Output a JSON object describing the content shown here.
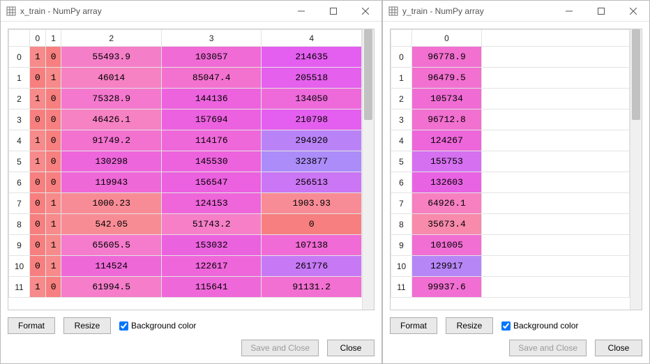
{
  "windows": {
    "left": {
      "title": "x_train - NumPy array",
      "columns": [
        "0",
        "1",
        "2",
        "3",
        "4"
      ],
      "row_headers": [
        "0",
        "1",
        "2",
        "3",
        "4",
        "5",
        "6",
        "7",
        "8",
        "9",
        "10",
        "11"
      ],
      "cells": [
        [
          {
            "v": "1",
            "c": "#f78a8a"
          },
          {
            "v": "0",
            "c": "#f77f7f"
          },
          {
            "v": "55493.9",
            "c": "#f57ec9"
          },
          {
            "v": "103057",
            "c": "#f06bd6"
          },
          {
            "v": "214635",
            "c": "#e45ef0"
          }
        ],
        [
          {
            "v": "0",
            "c": "#f77f7f"
          },
          {
            "v": "1",
            "c": "#f78a8a"
          },
          {
            "v": "46014",
            "c": "#f681c3"
          },
          {
            "v": "85047.4",
            "c": "#f372cf"
          },
          {
            "v": "205518",
            "c": "#e560ed"
          }
        ],
        [
          {
            "v": "1",
            "c": "#f78a8a"
          },
          {
            "v": "0",
            "c": "#f77f7f"
          },
          {
            "v": "75328.9",
            "c": "#f478ce"
          },
          {
            "v": "144136",
            "c": "#ec63dd"
          },
          {
            "v": "134050",
            "c": "#ee6adb"
          }
        ],
        [
          {
            "v": "0",
            "c": "#f77f7f"
          },
          {
            "v": "0",
            "c": "#f77f7f"
          },
          {
            "v": "46426.1",
            "c": "#f681c3"
          },
          {
            "v": "157694",
            "c": "#eb61df"
          },
          {
            "v": "210798",
            "c": "#e45fef"
          }
        ],
        [
          {
            "v": "1",
            "c": "#f78a8a"
          },
          {
            "v": "0",
            "c": "#f77f7f"
          },
          {
            "v": "91749.2",
            "c": "#f372cf"
          },
          {
            "v": "114176",
            "c": "#ef68d9"
          },
          {
            "v": "294920",
            "c": "#b983f7"
          }
        ],
        [
          {
            "v": "1",
            "c": "#f78a8a"
          },
          {
            "v": "0",
            "c": "#f77f7f"
          },
          {
            "v": "130298",
            "c": "#ee66db"
          },
          {
            "v": "145530",
            "c": "#ec63dd"
          },
          {
            "v": "323877",
            "c": "#ab8cf9"
          }
        ],
        [
          {
            "v": "0",
            "c": "#f77f7f"
          },
          {
            "v": "0",
            "c": "#f77f7f"
          },
          {
            "v": "119943",
            "c": "#ef68d8"
          },
          {
            "v": "156547",
            "c": "#eb61df"
          },
          {
            "v": "256513",
            "c": "#cb76f4"
          }
        ],
        [
          {
            "v": "0",
            "c": "#f77f7f"
          },
          {
            "v": "1",
            "c": "#f78a8a"
          },
          {
            "v": "1000.23",
            "c": "#f88c96"
          },
          {
            "v": "124153",
            "c": "#ee66da"
          },
          {
            "v": "1903.93",
            "c": "#f88c96"
          }
        ],
        [
          {
            "v": "0",
            "c": "#f77f7f"
          },
          {
            "v": "1",
            "c": "#f78a8a"
          },
          {
            "v": "542.05",
            "c": "#f88c95"
          },
          {
            "v": "51743.2",
            "c": "#f67fc8"
          },
          {
            "v": "0",
            "c": "#f77f7f"
          }
        ],
        [
          {
            "v": "0",
            "c": "#f77f7f"
          },
          {
            "v": "1",
            "c": "#f78a8a"
          },
          {
            "v": "65605.5",
            "c": "#f57bcc"
          },
          {
            "v": "153032",
            "c": "#eb62de"
          },
          {
            "v": "107138",
            "c": "#f06bd5"
          }
        ],
        [
          {
            "v": "0",
            "c": "#f77f7f"
          },
          {
            "v": "1",
            "c": "#f78a8a"
          },
          {
            "v": "114524",
            "c": "#ef68d8"
          },
          {
            "v": "122617",
            "c": "#ee66da"
          },
          {
            "v": "261776",
            "c": "#c779f5"
          }
        ],
        [
          {
            "v": "1",
            "c": "#f78a8a"
          },
          {
            "v": "0",
            "c": "#f77f7f"
          },
          {
            "v": "61994.5",
            "c": "#f57dca"
          },
          {
            "v": "115641",
            "c": "#ef68d9"
          },
          {
            "v": "91131.2",
            "c": "#f270d1"
          }
        ]
      ],
      "scroll_thumb": {
        "top": 0,
        "height": 130
      }
    },
    "right": {
      "title": "y_train - NumPy array",
      "columns": [
        "0"
      ],
      "row_headers": [
        "0",
        "1",
        "2",
        "3",
        "4",
        "5",
        "6",
        "7",
        "8",
        "9",
        "10",
        "11"
      ],
      "cells": [
        [
          {
            "v": "96778.9",
            "c": "#f270d0"
          }
        ],
        [
          {
            "v": "96479.5",
            "c": "#f270d0"
          }
        ],
        [
          {
            "v": "105734",
            "c": "#f06cd4"
          }
        ],
        [
          {
            "v": "96712.8",
            "c": "#f270d0"
          }
        ],
        [
          {
            "v": "124267",
            "c": "#ed66da"
          }
        ],
        [
          {
            "v": "155753",
            "c": "#d570f0"
          }
        ],
        [
          {
            "v": "132603",
            "c": "#e863e3"
          }
        ],
        [
          {
            "v": "64926.1",
            "c": "#f780c1"
          }
        ],
        [
          {
            "v": "35673.4",
            "c": "#f88aab"
          }
        ],
        [
          {
            "v": "101005",
            "c": "#f16ed3"
          }
        ],
        [
          {
            "v": "129917",
            "c": "#b786f6"
          }
        ],
        [
          {
            "v": "99937.6",
            "c": "#f16fd2"
          }
        ]
      ],
      "scroll_thumb": {
        "top": 0,
        "height": 130
      }
    }
  },
  "buttons": {
    "format": "Format",
    "resize": "Resize",
    "bg_color": "Background color",
    "save_close": "Save and Close",
    "close": "Close"
  }
}
